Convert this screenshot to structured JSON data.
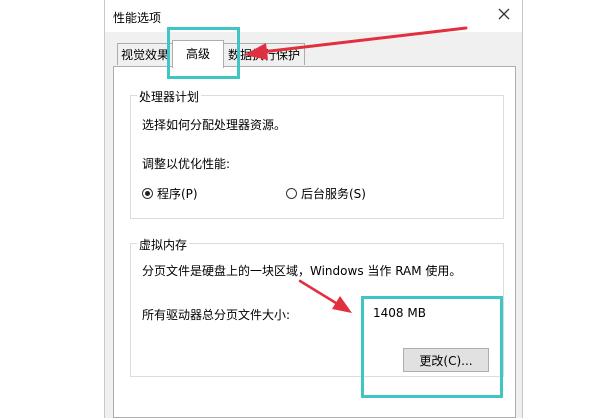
{
  "window": {
    "title": "性能选项"
  },
  "tabs": [
    {
      "label": "视觉效果"
    },
    {
      "label": "高级"
    },
    {
      "label": "数据执行保护"
    }
  ],
  "processor": {
    "group_title": "处理器计划",
    "description": "选择如何分配处理器资源。",
    "optimize_label": "调整以优化性能:",
    "options": [
      {
        "label": "程序(P)",
        "selected": true
      },
      {
        "label": "后台服务(S)",
        "selected": false
      }
    ]
  },
  "virtual_memory": {
    "group_title": "虚拟内存",
    "description": "分页文件是硬盘上的一块区域，Windows 当作 RAM 使用。",
    "total_label": "所有驱动器总分页文件大小:",
    "total_value": "1408 MB",
    "change_button": "更改(C)..."
  },
  "colors": {
    "highlight": "#40c4c4",
    "arrow": "#e03040"
  },
  "icons": {
    "close": "close-icon"
  }
}
